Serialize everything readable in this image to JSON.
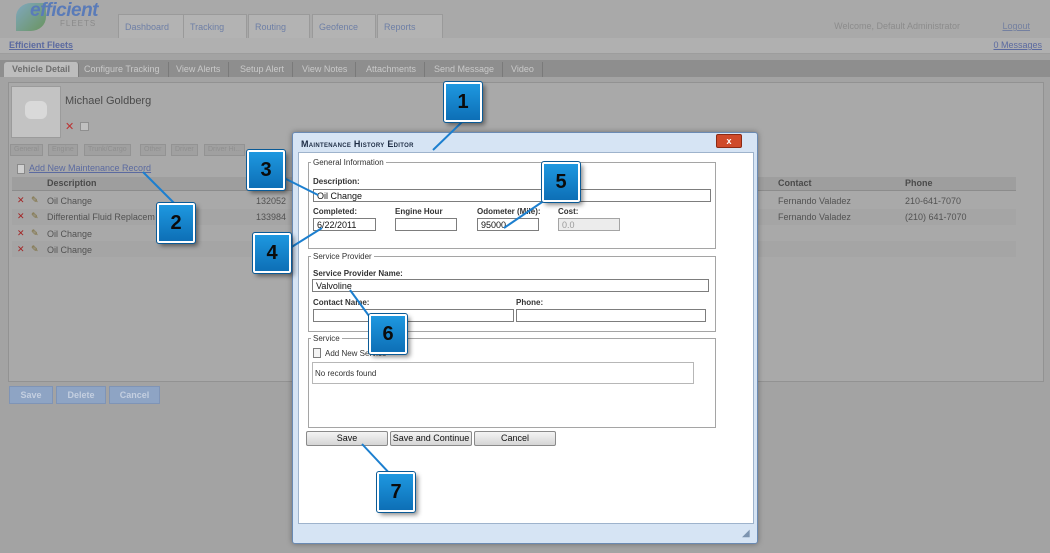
{
  "header": {
    "logo_main": "efficient",
    "logo_sub": "FLEETS",
    "nav_tabs": [
      "Dashboard",
      "Tracking",
      "Routing",
      "Geofence",
      "Reports"
    ],
    "welcome": "Welcome, Default Administrator",
    "logout": "Logout"
  },
  "breadcrumb": {
    "root": "Efficient Fleets",
    "messages": "0 Messages"
  },
  "subtabs": [
    "Vehicle Detail",
    "Configure Tracking",
    "View Alerts",
    "Setup Alert",
    "View Notes",
    "Attachments",
    "Send Message",
    "Video"
  ],
  "profile": {
    "name": "Michael Goldberg"
  },
  "detail_tabs": [
    "General",
    "Engine",
    "Trunk/Cargo",
    "Other",
    "Driver",
    "Driver Hi..."
  ],
  "records": {
    "add_label": "Add New Maintenance Record",
    "columns": {
      "description": "Description",
      "contact": "Contact",
      "phone": "Phone"
    },
    "rows": [
      {
        "description": "Oil Change",
        "odometer": "132052",
        "contact": "Fernando Valadez",
        "phone": "210-641-7070"
      },
      {
        "description": "Differential Fluid Replacem",
        "odometer": "133984",
        "contact": "Fernando Valadez",
        "phone": "(210) 641-7070"
      },
      {
        "description": "Oil Change",
        "odometer": "",
        "contact": "",
        "phone": ""
      },
      {
        "description": "Oil Change",
        "odometer": "",
        "contact": "",
        "phone": ""
      }
    ]
  },
  "page_buttons": {
    "save": "Save",
    "delete": "Delete",
    "cancel": "Cancel"
  },
  "modal": {
    "title": "Maintenance History Editor",
    "close_label": "x",
    "general": {
      "legend": "General Information",
      "description_label": "Description:",
      "description_value": "Oil Change",
      "completed_label": "Completed:",
      "completed_value": "6/22/2011",
      "engine_hour_label": "Engine Hour",
      "engine_hour_value": "",
      "odometer_label": "Odometer (Mile):",
      "odometer_value": "95000",
      "cost_label": "Cost:",
      "cost_value": "0.0"
    },
    "provider": {
      "legend": "Service Provider",
      "name_label": "Service Provider Name:",
      "name_value": "Valvoline",
      "contact_label": "Contact Name:",
      "contact_value": "",
      "phone_label": "Phone:",
      "phone_value": ""
    },
    "service": {
      "legend": "Service",
      "add_label": "Add New Service",
      "empty_text": "No records found"
    },
    "buttons": {
      "save": "Save",
      "save_continue": "Save and Continue",
      "cancel": "Cancel"
    }
  },
  "callouts": [
    "1",
    "2",
    "3",
    "4",
    "5",
    "6",
    "7"
  ]
}
